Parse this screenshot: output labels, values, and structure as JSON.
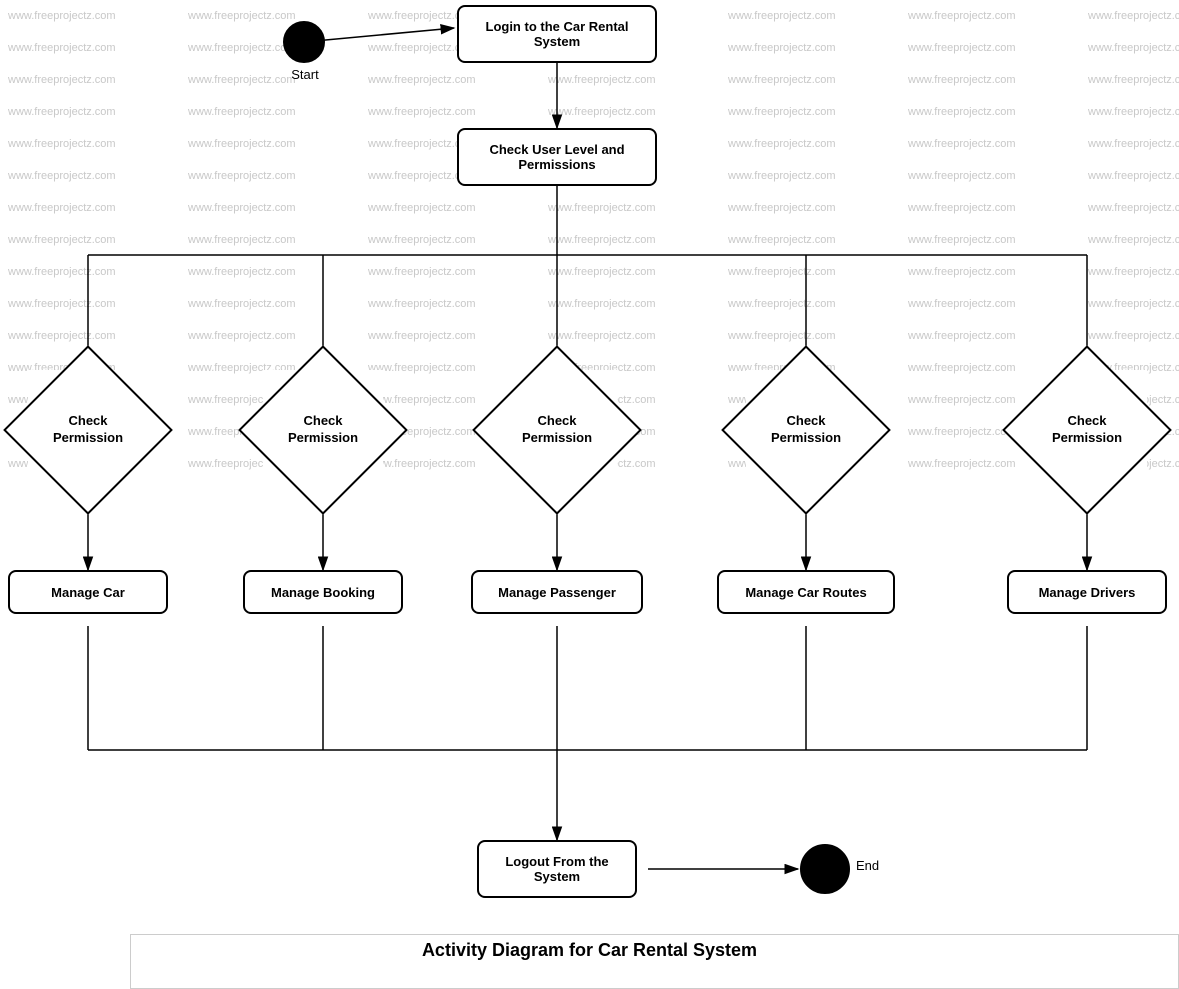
{
  "title": "Activity Diagram for Car Rental System",
  "watermark": "www.freeprojectz.com",
  "nodes": {
    "start": {
      "label": "Start"
    },
    "login": {
      "label": "Login to the Car Rental\nSystem"
    },
    "check_user": {
      "label": "Check User Level and\nPermissions"
    },
    "perm1": {
      "label": "Check\nPermission"
    },
    "perm2": {
      "label": "Check\nPermission"
    },
    "perm3": {
      "label": "Check\nPermission"
    },
    "perm4": {
      "label": "Check\nPermission"
    },
    "perm5": {
      "label": "Check\nPermission"
    },
    "manage_car": {
      "label": "Manage Car"
    },
    "manage_booking": {
      "label": "Manage Booking"
    },
    "manage_passenger": {
      "label": "Manage Passenger"
    },
    "manage_car_routes": {
      "label": "Manage Car Routes"
    },
    "manage_drivers": {
      "label": "Manage Drivers"
    },
    "logout": {
      "label": "Logout From the\nSystem"
    },
    "end": {
      "label": "End"
    }
  }
}
